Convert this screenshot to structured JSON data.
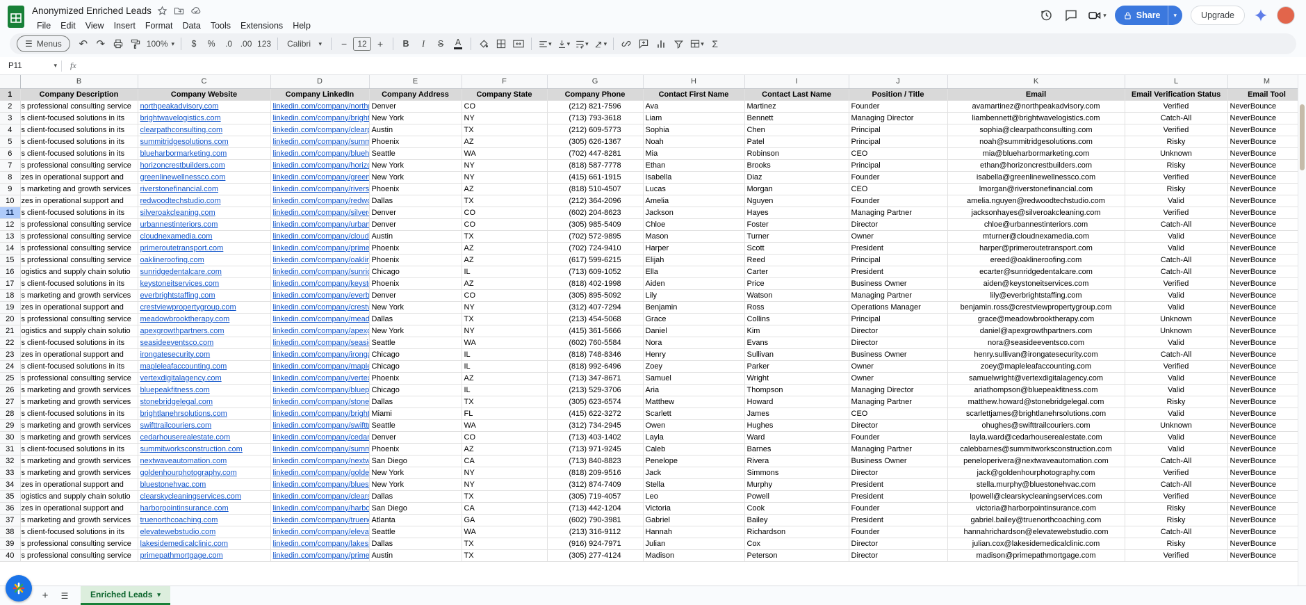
{
  "app": {
    "title": "Anonymized Enriched Leads",
    "menus": [
      "File",
      "Edit",
      "View",
      "Insert",
      "Format",
      "Data",
      "Tools",
      "Extensions",
      "Help"
    ],
    "share_label": "Share",
    "upgrade_label": "Upgrade"
  },
  "icons": {
    "caret": "▾",
    "hamburger": "☰",
    "undo": "↶",
    "redo": "↷",
    "plus": "+",
    "minus": "−",
    "sigma": "Σ"
  },
  "toolbar": {
    "menus_label": "Menus",
    "zoom": "100%",
    "currency": "$",
    "percent": "%",
    "decrease_decimal": ".0",
    "increase_decimal": ".00",
    "more_formats": "123",
    "font": "Calibri",
    "font_size": "12",
    "bold": "B",
    "italic": "I",
    "strikethrough": "S",
    "text_color": "A"
  },
  "formula_bar": {
    "cell_ref": "P11",
    "fx_label": "fx",
    "value": ""
  },
  "sheet": {
    "columns": [
      "B",
      "C",
      "D",
      "E",
      "F",
      "G",
      "H",
      "I",
      "J",
      "K",
      "L",
      "M"
    ],
    "header_row_num": "1",
    "headers": [
      "Company Description",
      "Company Website",
      "Company LinkedIn",
      "Company Address",
      "Company State",
      "Company Phone",
      "Contact First Name",
      "Contact Last Name",
      "Position / Title",
      "Email",
      "Email Verification Status",
      "Email Tool"
    ],
    "rows": [
      {
        "n": "2",
        "c": [
          "s professional consulting service",
          "northpeakadvisory.com",
          "linkedin.com/company/northpeakadvisory",
          "Denver",
          "CO",
          "(212) 821-7596",
          "Ava",
          "Martinez",
          "Founder",
          "avamartinez@northpeakadvisory.com",
          "Verified",
          "NeverBounce"
        ]
      },
      {
        "n": "3",
        "c": [
          "s client-focused solutions in its",
          "brightwavelogistics.com",
          "linkedin.com/company/brightwavelogistics",
          "New York",
          "NY",
          "(713) 793-3618",
          "Liam",
          "Bennett",
          "Managing Director",
          "liambennett@brightwavelogistics.com",
          "Catch-All",
          "NeverBounce"
        ]
      },
      {
        "n": "4",
        "c": [
          "s client-focused solutions in its",
          "clearpathconsulting.com",
          "linkedin.com/company/clearpathconsulting",
          "Austin",
          "TX",
          "(212) 609-5773",
          "Sophia",
          "Chen",
          "Principal",
          "sophia@clearpathconsulting.com",
          "Verified",
          "NeverBounce"
        ]
      },
      {
        "n": "5",
        "c": [
          "s client-focused solutions in its",
          "summitridgesolutions.com",
          "linkedin.com/company/summitridgesolutions",
          "Phoenix",
          "AZ",
          "(305) 626-1367",
          "Noah",
          "Patel",
          "Principal",
          "noah@summitridgesolutions.com",
          "Risky",
          "NeverBounce"
        ]
      },
      {
        "n": "6",
        "c": [
          "s client-focused solutions in its",
          "blueharbormarketing.com",
          "linkedin.com/company/blueharbormarketing",
          "Seattle",
          "WA",
          "(702) 447-8281",
          "Mia",
          "Robinson",
          "CEO",
          "mia@blueharbormarketing.com",
          "Unknown",
          "NeverBounce"
        ]
      },
      {
        "n": "7",
        "c": [
          "s professional consulting service",
          "horizoncrestbuilders.com",
          "linkedin.com/company/horizoncrestbuilders",
          "New York",
          "NY",
          "(818) 587-7778",
          "Ethan",
          "Brooks",
          "Principal",
          "ethan@horizoncrestbuilders.com",
          "Risky",
          "NeverBounce"
        ]
      },
      {
        "n": "8",
        "c": [
          "zes in operational support and",
          "greenlinewellnessco.com",
          "linkedin.com/company/greenlinewellnessco",
          "New York",
          "NY",
          "(415) 661-1915",
          "Isabella",
          "Diaz",
          "Founder",
          "isabella@greenlinewellnessco.com",
          "Verified",
          "NeverBounce"
        ]
      },
      {
        "n": "9",
        "c": [
          "s marketing and growth services",
          "riverstonefinancial.com",
          "linkedin.com/company/riverstonefinancial",
          "Phoenix",
          "AZ",
          "(818) 510-4507",
          "Lucas",
          "Morgan",
          "CEO",
          "lmorgan@riverstonefinancial.com",
          "Risky",
          "NeverBounce"
        ]
      },
      {
        "n": "10",
        "c": [
          "zes in operational support and",
          "redwoodtechstudio.com",
          "linkedin.com/company/redwoodtechstudio",
          "Dallas",
          "TX",
          "(212) 364-2096",
          "Amelia",
          "Nguyen",
          "Founder",
          "amelia.nguyen@redwoodtechstudio.com",
          "Valid",
          "NeverBounce"
        ]
      },
      {
        "n": "11",
        "sel": true,
        "c": [
          "s client-focused solutions in its",
          "silveroakcleaning.com",
          "linkedin.com/company/silveroakcleaning",
          "Denver",
          "CO",
          "(602) 204-8623",
          "Jackson",
          "Hayes",
          "Managing Partner",
          "jacksonhayes@silveroakcleaning.com",
          "Verified",
          "NeverBounce"
        ]
      },
      {
        "n": "12",
        "c": [
          "s professional consulting service",
          "urbannestinteriors.com",
          "linkedin.com/company/urbannestinteriors",
          "Denver",
          "CO",
          "(305) 985-5409",
          "Chloe",
          "Foster",
          "Director",
          "chloe@urbannestinteriors.com",
          "Catch-All",
          "NeverBounce"
        ]
      },
      {
        "n": "13",
        "c": [
          "s professional consulting service",
          "cloudnexamedia.com",
          "linkedin.com/company/cloudnexamedia",
          "Austin",
          "TX",
          "(702) 572-9895",
          "Mason",
          "Turner",
          "Owner",
          "mturner@cloudnexamedia.com",
          "Valid",
          "NeverBounce"
        ]
      },
      {
        "n": "14",
        "c": [
          "s professional consulting service",
          "primeroutetransport.com",
          "linkedin.com/company/primeroutetransport",
          "Phoenix",
          "AZ",
          "(702) 724-9410",
          "Harper",
          "Scott",
          "President",
          "harper@primeroutetransport.com",
          "Valid",
          "NeverBounce"
        ]
      },
      {
        "n": "15",
        "c": [
          "s professional consulting service",
          "oaklineroofing.com",
          "linkedin.com/company/oaklineroofing",
          "Phoenix",
          "AZ",
          "(617) 599-6215",
          "Elijah",
          "Reed",
          "Principal",
          "ereed@oaklineroofing.com",
          "Catch-All",
          "NeverBounce"
        ]
      },
      {
        "n": "16",
        "c": [
          "ogistics and supply chain solutio",
          "sunridgedentalcare.com",
          "linkedin.com/company/sunridgedentalcare",
          "Chicago",
          "IL",
          "(713) 609-1052",
          "Ella",
          "Carter",
          "President",
          "ecarter@sunridgedentalcare.com",
          "Catch-All",
          "NeverBounce"
        ]
      },
      {
        "n": "17",
        "c": [
          "s client-focused solutions in its",
          "keystoneitservices.com",
          "linkedin.com/company/keystoneitservices",
          "Phoenix",
          "AZ",
          "(818) 402-1998",
          "Aiden",
          "Price",
          "Business Owner",
          "aiden@keystoneitservices.com",
          "Verified",
          "NeverBounce"
        ]
      },
      {
        "n": "18",
        "c": [
          "s marketing and growth services",
          "everbrightstaffing.com",
          "linkedin.com/company/everbrightstaffing",
          "Denver",
          "CO",
          "(305) 895-5092",
          "Lily",
          "Watson",
          "Managing Partner",
          "lily@everbrightstaffing.com",
          "Valid",
          "NeverBounce"
        ]
      },
      {
        "n": "19",
        "c": [
          "zes in operational support and",
          "crestviewpropertygroup.com",
          "linkedin.com/company/crestviewpropertygroup",
          "New York",
          "NY",
          "(312) 407-7294",
          "Benjamin",
          "Ross",
          "Operations Manager",
          "benjamin.ross@crestviewpropertygroup.com",
          "Valid",
          "NeverBounce"
        ]
      },
      {
        "n": "20",
        "c": [
          "s professional consulting service",
          "meadowbrooktherapy.com",
          "linkedin.com/company/meadowbrooktherapy",
          "Dallas",
          "TX",
          "(213) 454-5068",
          "Grace",
          "Collins",
          "Principal",
          "grace@meadowbrooktherapy.com",
          "Unknown",
          "NeverBounce"
        ]
      },
      {
        "n": "21",
        "c": [
          "ogistics and supply chain solutio",
          "apexgrowthpartners.com",
          "linkedin.com/company/apexgrowthpartners",
          "New York",
          "NY",
          "(415) 361-5666",
          "Daniel",
          "Kim",
          "Director",
          "daniel@apexgrowthpartners.com",
          "Unknown",
          "NeverBounce"
        ]
      },
      {
        "n": "22",
        "c": [
          "s client-focused solutions in its",
          "seasideeventsco.com",
          "linkedin.com/company/seasideeventsco",
          "Seattle",
          "WA",
          "(602) 760-5584",
          "Nora",
          "Evans",
          "Director",
          "nora@seasideeventsco.com",
          "Valid",
          "NeverBounce"
        ]
      },
      {
        "n": "23",
        "c": [
          "zes in operational support and",
          "irongatesecurity.com",
          "linkedin.com/company/irongatesecurity",
          "Chicago",
          "IL",
          "(818) 748-8346",
          "Henry",
          "Sullivan",
          "Business Owner",
          "henry.sullivan@irongatesecurity.com",
          "Catch-All",
          "NeverBounce"
        ]
      },
      {
        "n": "24",
        "c": [
          "s client-focused solutions in its",
          "mapleleafaccounting.com",
          "linkedin.com/company/mapleleafaccounting",
          "Chicago",
          "IL",
          "(818) 992-6496",
          "Zoey",
          "Parker",
          "Owner",
          "zoey@mapleleafaccounting.com",
          "Verified",
          "NeverBounce"
        ]
      },
      {
        "n": "25",
        "c": [
          "s professional consulting service",
          "vertexdigitalagency.com",
          "linkedin.com/company/vertexdigitalagency",
          "Phoenix",
          "AZ",
          "(713) 347-8671",
          "Samuel",
          "Wright",
          "Owner",
          "samuelwright@vertexdigitalagency.com",
          "Valid",
          "NeverBounce"
        ]
      },
      {
        "n": "26",
        "c": [
          "s marketing and growth services",
          "bluepeakfitness.com",
          "linkedin.com/company/bluepeakfitness",
          "Chicago",
          "IL",
          "(213) 529-3706",
          "Aria",
          "Thompson",
          "Managing Director",
          "ariathompson@bluepeakfitness.com",
          "Valid",
          "NeverBounce"
        ]
      },
      {
        "n": "27",
        "c": [
          "s marketing and growth services",
          "stonebridgelegal.com",
          "linkedin.com/company/stonebridgelegal",
          "Dallas",
          "TX",
          "(305) 623-6574",
          "Matthew",
          "Howard",
          "Managing Partner",
          "matthew.howard@stonebridgelegal.com",
          "Risky",
          "NeverBounce"
        ]
      },
      {
        "n": "28",
        "c": [
          "s client-focused solutions in its",
          "brightlanehrsolutions.com",
          "linkedin.com/company/brightlanehrsolutions",
          "Miami",
          "FL",
          "(415) 622-3272",
          "Scarlett",
          "James",
          "CEO",
          "scarlettjames@brightlanehrsolutions.com",
          "Valid",
          "NeverBounce"
        ]
      },
      {
        "n": "29",
        "c": [
          "s marketing and growth services",
          "swifttrailcouriers.com",
          "linkedin.com/company/swifttrailcouriers",
          "Seattle",
          "WA",
          "(312) 734-2945",
          "Owen",
          "Hughes",
          "Director",
          "ohughes@swifttrailcouriers.com",
          "Unknown",
          "NeverBounce"
        ]
      },
      {
        "n": "30",
        "c": [
          "s marketing and growth services",
          "cedarhouserealestate.com",
          "linkedin.com/company/cedarhouserealestate",
          "Denver",
          "CO",
          "(713) 403-1402",
          "Layla",
          "Ward",
          "Founder",
          "layla.ward@cedarhouserealestate.com",
          "Valid",
          "NeverBounce"
        ]
      },
      {
        "n": "31",
        "c": [
          "s client-focused solutions in its",
          "summitworksconstruction.com",
          "linkedin.com/company/summitworksconstruction",
          "Phoenix",
          "AZ",
          "(713) 971-9245",
          "Caleb",
          "Barnes",
          "Managing Partner",
          "calebbarnes@summitworksconstruction.com",
          "Valid",
          "NeverBounce"
        ]
      },
      {
        "n": "32",
        "c": [
          "s marketing and growth services",
          "nextwaveautomation.com",
          "linkedin.com/company/nextwaveautomation",
          "San Diego",
          "CA",
          "(713) 840-8823",
          "Penelope",
          "Rivera",
          "Business Owner",
          "peneloperivera@nextwaveautomation.com",
          "Catch-All",
          "NeverBounce"
        ]
      },
      {
        "n": "33",
        "c": [
          "s marketing and growth services",
          "goldenhourphotography.com",
          "linkedin.com/company/goldenhourphotography",
          "New York",
          "NY",
          "(818) 209-9516",
          "Jack",
          "Simmons",
          "Director",
          "jack@goldenhourphotography.com",
          "Verified",
          "NeverBounce"
        ]
      },
      {
        "n": "34",
        "c": [
          "zes in operational support and",
          "bluestonehvac.com",
          "linkedin.com/company/bluestonehvac",
          "New York",
          "NY",
          "(312) 874-7409",
          "Stella",
          "Murphy",
          "President",
          "stella.murphy@bluestonehvac.com",
          "Catch-All",
          "NeverBounce"
        ]
      },
      {
        "n": "35",
        "c": [
          "ogistics and supply chain solutio",
          "clearskycleaningservices.com",
          "linkedin.com/company/clearskycleaningservices",
          "Dallas",
          "TX",
          "(305) 719-4057",
          "Leo",
          "Powell",
          "President",
          "lpowell@clearskycleaningservices.com",
          "Verified",
          "NeverBounce"
        ]
      },
      {
        "n": "36",
        "c": [
          "zes in operational support and",
          "harborpointinsurance.com",
          "linkedin.com/company/harborpointinsurance",
          "San Diego",
          "CA",
          "(713) 442-1204",
          "Victoria",
          "Cook",
          "Founder",
          "victoria@harborpointinsurance.com",
          "Risky",
          "NeverBounce"
        ]
      },
      {
        "n": "37",
        "c": [
          "s marketing and growth services",
          "truenorthcoaching.com",
          "linkedin.com/company/truenorthcoaching",
          "Atlanta",
          "GA",
          "(602) 790-3981",
          "Gabriel",
          "Bailey",
          "President",
          "gabriel.bailey@truenorthcoaching.com",
          "Risky",
          "NeverBounce"
        ]
      },
      {
        "n": "38",
        "c": [
          "s client-focused solutions in its",
          "elevatewebstudio.com",
          "linkedin.com/company/elevatewebstudio",
          "Seattle",
          "WA",
          "(213) 316-9112",
          "Hannah",
          "Richardson",
          "Founder",
          "hannahrichardson@elevatewebstudio.com",
          "Catch-All",
          "NeverBounce"
        ]
      },
      {
        "n": "39",
        "c": [
          "s professional consulting service",
          "lakesidemedicalclinic.com",
          "linkedin.com/company/lakesidemedicalclinic",
          "Dallas",
          "TX",
          "(916) 924-7971",
          "Julian",
          "Cox",
          "Director",
          "julian.cox@lakesidemedicalclinic.com",
          "Risky",
          "NeverBounce"
        ]
      },
      {
        "n": "40",
        "c": [
          "s professional consulting service",
          "primepathmortgage.com",
          "linkedin.com/company/primepathmortgage",
          "Austin",
          "TX",
          "(305) 277-4124",
          "Madison",
          "Peterson",
          "Director",
          "madison@primepathmortgage.com",
          "Verified",
          "NeverBounce"
        ]
      }
    ]
  },
  "tabs": {
    "active_label": "Enriched Leads"
  }
}
